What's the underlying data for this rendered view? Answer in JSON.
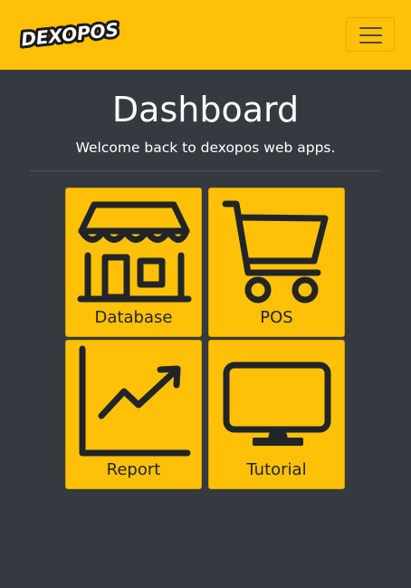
{
  "app": {
    "brand_name": "DEXOPOS"
  },
  "header": {
    "title": "Dashboard",
    "subtitle": "Welcome back to dexopos web apps."
  },
  "tiles": [
    {
      "label": "Database",
      "icon": "store-icon"
    },
    {
      "label": "POS",
      "icon": "cart-icon"
    },
    {
      "label": "Report",
      "icon": "chart-line-icon"
    },
    {
      "label": "Tutorial",
      "icon": "monitor-icon"
    }
  ],
  "colors": {
    "navbar": "#ffc107",
    "background": "#343a40",
    "tile": "#ffc107",
    "icon": "#212529",
    "text_dark": "#212529",
    "text_light": "#ffffff"
  }
}
